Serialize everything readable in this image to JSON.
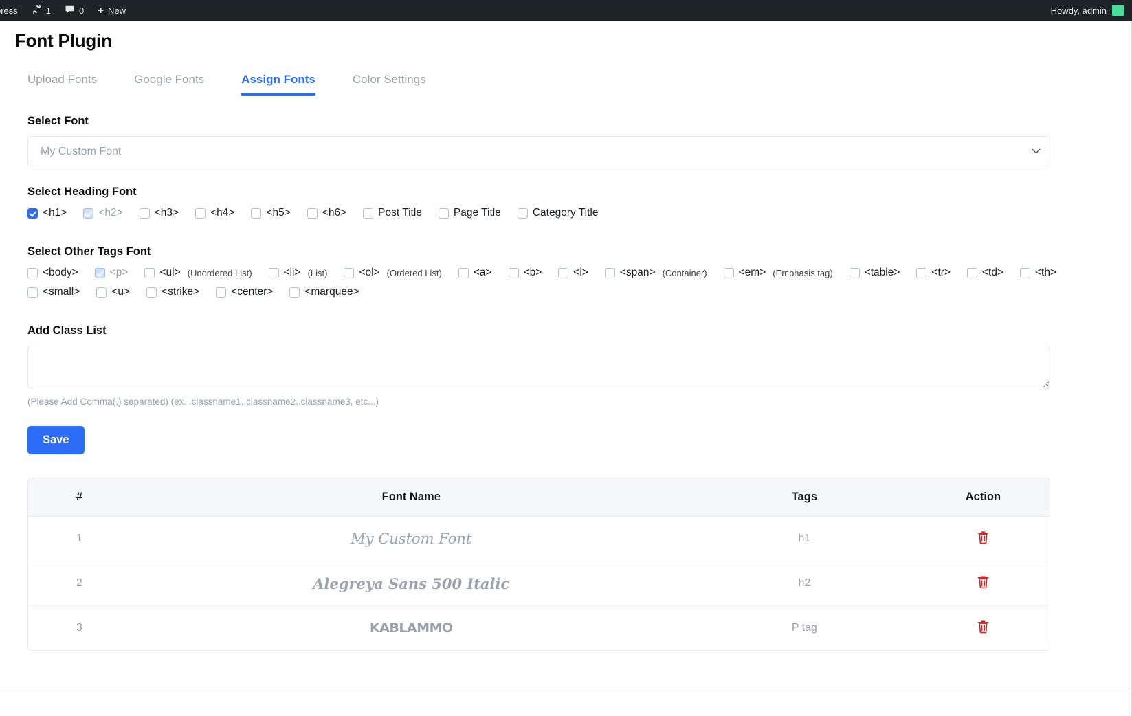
{
  "adminbar": {
    "site_name": "press",
    "updates_icon": "refresh-icon",
    "updates_count": "1",
    "comments_icon": "comment-icon",
    "comments_count": "0",
    "new_icon": "plus-icon",
    "new_label": "New",
    "howdy": "Howdy, admin",
    "avatar_color": "#4ade9b",
    "background": "#1d2327"
  },
  "page": {
    "title": "Font Plugin",
    "accent_color": "#2d6cf6"
  },
  "tabs": [
    {
      "label": "Upload Fonts",
      "active": false
    },
    {
      "label": "Google Fonts",
      "active": false
    },
    {
      "label": "Assign Fonts",
      "active": true
    },
    {
      "label": "Color Settings",
      "active": false
    }
  ],
  "select_font": {
    "label": "Select Font",
    "value": "My Custom Font",
    "options": [
      "My Custom Font"
    ],
    "chevron_icon": "chevron-down-icon"
  },
  "heading_font": {
    "label": "Select Heading Font",
    "items": [
      {
        "label": "<h1>",
        "hint": "",
        "checked": true,
        "muted": false
      },
      {
        "label": "<h2>",
        "hint": "",
        "checked": true,
        "muted": true
      },
      {
        "label": "<h3>",
        "hint": "",
        "checked": false,
        "muted": false
      },
      {
        "label": "<h4>",
        "hint": "",
        "checked": false,
        "muted": false
      },
      {
        "label": "<h5>",
        "hint": "",
        "checked": false,
        "muted": false
      },
      {
        "label": "<h6>",
        "hint": "",
        "checked": false,
        "muted": false
      },
      {
        "label": "Post Title",
        "hint": "",
        "checked": false,
        "muted": false
      },
      {
        "label": "Page Title",
        "hint": "",
        "checked": false,
        "muted": false
      },
      {
        "label": "Category Title",
        "hint": "",
        "checked": false,
        "muted": false
      }
    ]
  },
  "other_tags": {
    "label": "Select Other Tags Font",
    "items": [
      {
        "label": "<body>",
        "hint": "",
        "checked": false,
        "muted": false
      },
      {
        "label": "<p>",
        "hint": "",
        "checked": true,
        "muted": true
      },
      {
        "label": "<ul>",
        "hint": "(Unordered List)",
        "checked": false,
        "muted": false
      },
      {
        "label": "<li>",
        "hint": "(List)",
        "checked": false,
        "muted": false
      },
      {
        "label": "<ol>",
        "hint": "(Ordered List)",
        "checked": false,
        "muted": false
      },
      {
        "label": "<a>",
        "hint": "",
        "checked": false,
        "muted": false
      },
      {
        "label": "<b>",
        "hint": "",
        "checked": false,
        "muted": false
      },
      {
        "label": "<i>",
        "hint": "",
        "checked": false,
        "muted": false
      },
      {
        "label": "<span>",
        "hint": "(Container)",
        "checked": false,
        "muted": false
      },
      {
        "label": "<em>",
        "hint": "(Emphasis tag)",
        "checked": false,
        "muted": false
      },
      {
        "label": "<table>",
        "hint": "",
        "checked": false,
        "muted": false
      },
      {
        "label": "<tr>",
        "hint": "",
        "checked": false,
        "muted": false
      },
      {
        "label": "<td>",
        "hint": "",
        "checked": false,
        "muted": false
      },
      {
        "label": "<th>",
        "hint": "",
        "checked": false,
        "muted": false
      },
      {
        "label": "<small>",
        "hint": "",
        "checked": false,
        "muted": false
      },
      {
        "label": "<u>",
        "hint": "",
        "checked": false,
        "muted": false
      },
      {
        "label": "<strike>",
        "hint": "",
        "checked": false,
        "muted": false
      },
      {
        "label": "<center>",
        "hint": "",
        "checked": false,
        "muted": false
      },
      {
        "label": "<marquee>",
        "hint": "",
        "checked": false,
        "muted": false
      }
    ]
  },
  "class_list": {
    "label": "Add Class List",
    "value": "",
    "placeholder": "",
    "hint": "(Please Add Comma(,) separated) (ex. .classname1,.classname2,.classname3, etc...)"
  },
  "save_button": {
    "label": "Save",
    "color": "#2d6cf6"
  },
  "table": {
    "columns": [
      "#",
      "Font Name",
      "Tags",
      "Action"
    ],
    "delete_icon": "trash-icon",
    "delete_icon_color": "#d42828",
    "rows": [
      {
        "num": "1",
        "font_name": "My Custom Font",
        "tags": "h1",
        "action": "Delete"
      },
      {
        "num": "2",
        "font_name": "Alegreya Sans 500 Italic",
        "tags": "h2",
        "action": "Delete"
      },
      {
        "num": "3",
        "font_name": "KABLAMMO",
        "tags": "P tag",
        "action": "Delete"
      }
    ]
  }
}
